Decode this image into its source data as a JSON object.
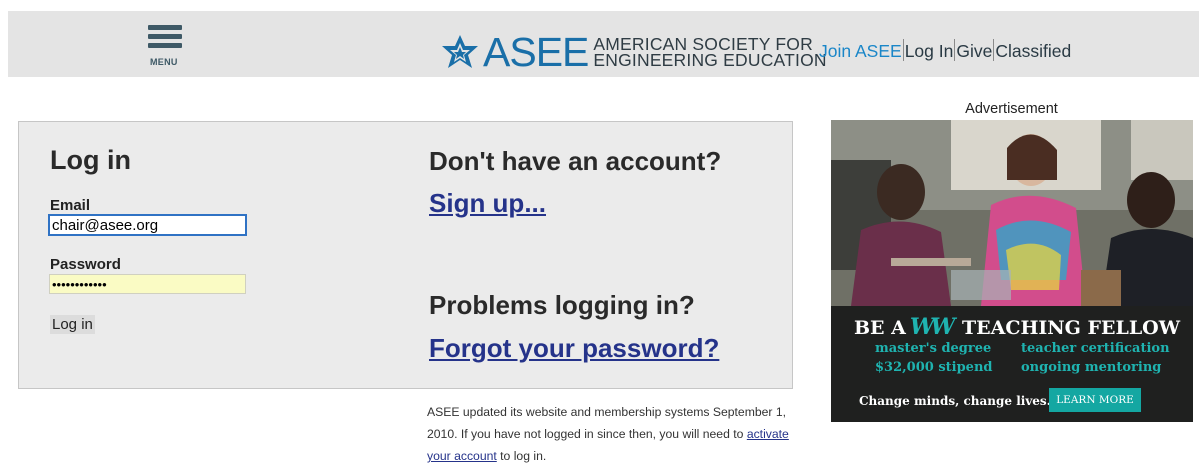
{
  "header": {
    "menu_label": "MENU",
    "logo_word": "ASEE",
    "logo_sub_line1": "AMERICAN SOCIETY FOR",
    "logo_sub_line2": "ENGINEERING EDUCATION",
    "links": {
      "join": "Join ASEE",
      "login": "Log In",
      "give": "Give",
      "classified": "Classified"
    }
  },
  "login": {
    "title": "Log in",
    "email_label": "Email",
    "email_value": "chair@asee.org",
    "password_label": "Password",
    "password_value": "••••••••••••",
    "submit_label": "Log in"
  },
  "account": {
    "title": "Don't have an account?",
    "signup_link": "Sign up...",
    "problems_title": "Problems logging in?",
    "forgot_link": "Forgot your password?"
  },
  "notice": {
    "text_before": "ASEE updated its website and membership systems September 1, 2010. If you have not logged in since then, you will need to ",
    "link_text": "activate your account",
    "text_after": " to log in."
  },
  "ad": {
    "label": "Advertisement",
    "headline_left": "BE A",
    "headline_logo": "WW",
    "headline_right": "TEACHING FELLOW",
    "items": [
      "master's degree",
      "teacher certification",
      "$32,000 stipend",
      "ongoing mentoring"
    ],
    "tagline": "Change minds, change lives.",
    "cta": "LEARN MORE"
  },
  "colors": {
    "brand_blue": "#1a6fa8",
    "link_blue": "#25338a",
    "ad_teal": "#1fb3b0"
  }
}
